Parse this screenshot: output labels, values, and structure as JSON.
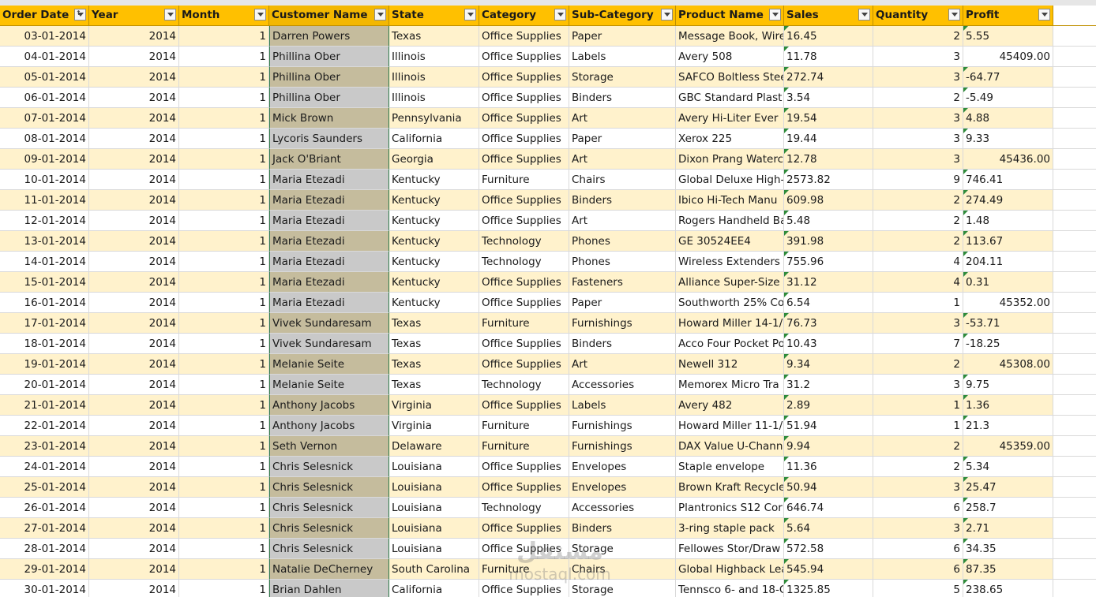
{
  "columns": [
    {
      "key": "order_date",
      "label": "Order Date"
    },
    {
      "key": "year",
      "label": "Year"
    },
    {
      "key": "month",
      "label": "Month"
    },
    {
      "key": "customer",
      "label": "Customer Name"
    },
    {
      "key": "state",
      "label": "State"
    },
    {
      "key": "category",
      "label": "Category"
    },
    {
      "key": "subcategory",
      "label": "Sub-Category"
    },
    {
      "key": "product",
      "label": "Product Name"
    },
    {
      "key": "sales",
      "label": "Sales"
    },
    {
      "key": "quantity",
      "label": "Quantity"
    },
    {
      "key": "profit",
      "label": "Profit"
    }
  ],
  "sorted_column": "order_date",
  "selected_column": "customer",
  "rows": [
    [
      "03-01-2014",
      "2014",
      "1",
      "Darren Powers",
      "Texas",
      "Office Supplies",
      "Paper",
      "Message Book, Wire",
      "16.45",
      "2",
      "5.55"
    ],
    [
      "04-01-2014",
      "2014",
      "1",
      "Phillina Ober",
      "Illinois",
      "Office Supplies",
      "Labels",
      "Avery 508",
      "11.78",
      "3",
      "45409.00"
    ],
    [
      "05-01-2014",
      "2014",
      "1",
      "Phillina Ober",
      "Illinois",
      "Office Supplies",
      "Storage",
      "SAFCO Boltless Stee",
      "272.74",
      "3",
      "-64.77"
    ],
    [
      "06-01-2014",
      "2014",
      "1",
      "Phillina Ober",
      "Illinois",
      "Office Supplies",
      "Binders",
      "GBC Standard Plast",
      "3.54",
      "2",
      "-5.49"
    ],
    [
      "07-01-2014",
      "2014",
      "1",
      "Mick Brown",
      "Pennsylvania",
      "Office Supplies",
      "Art",
      "Avery Hi-Liter Ever",
      "19.54",
      "3",
      "4.88"
    ],
    [
      "08-01-2014",
      "2014",
      "1",
      "Lycoris Saunders",
      "California",
      "Office Supplies",
      "Paper",
      "Xerox 225",
      "19.44",
      "3",
      "9.33"
    ],
    [
      "09-01-2014",
      "2014",
      "1",
      "Jack O'Briant",
      "Georgia",
      "Office Supplies",
      "Art",
      "Dixon Prang Waterc",
      "12.78",
      "3",
      "45436.00"
    ],
    [
      "10-01-2014",
      "2014",
      "1",
      "Maria Etezadi",
      "Kentucky",
      "Furniture",
      "Chairs",
      "Global Deluxe High-",
      "2573.82",
      "9",
      "746.41"
    ],
    [
      "11-01-2014",
      "2014",
      "1",
      "Maria Etezadi",
      "Kentucky",
      "Office Supplies",
      "Binders",
      "Ibico Hi-Tech Manu",
      "609.98",
      "2",
      "274.49"
    ],
    [
      "12-01-2014",
      "2014",
      "1",
      "Maria Etezadi",
      "Kentucky",
      "Office Supplies",
      "Art",
      "Rogers Handheld Ba",
      "5.48",
      "2",
      "1.48"
    ],
    [
      "13-01-2014",
      "2014",
      "1",
      "Maria Etezadi",
      "Kentucky",
      "Technology",
      "Phones",
      "GE 30524EE4",
      "391.98",
      "2",
      "113.67"
    ],
    [
      "14-01-2014",
      "2014",
      "1",
      "Maria Etezadi",
      "Kentucky",
      "Technology",
      "Phones",
      "Wireless Extenders",
      "755.96",
      "4",
      "204.11"
    ],
    [
      "15-01-2014",
      "2014",
      "1",
      "Maria Etezadi",
      "Kentucky",
      "Office Supplies",
      "Fasteners",
      "Alliance Super-Size",
      "31.12",
      "4",
      "0.31"
    ],
    [
      "16-01-2014",
      "2014",
      "1",
      "Maria Etezadi",
      "Kentucky",
      "Office Supplies",
      "Paper",
      "Southworth 25% Co",
      "6.54",
      "1",
      "45352.00"
    ],
    [
      "17-01-2014",
      "2014",
      "1",
      "Vivek Sundaresam",
      "Texas",
      "Furniture",
      "Furnishings",
      "Howard Miller 14-1/",
      "76.73",
      "3",
      "-53.71"
    ],
    [
      "18-01-2014",
      "2014",
      "1",
      "Vivek Sundaresam",
      "Texas",
      "Office Supplies",
      "Binders",
      "Acco Four Pocket Po",
      "10.43",
      "7",
      "-18.25"
    ],
    [
      "19-01-2014",
      "2014",
      "1",
      "Melanie Seite",
      "Texas",
      "Office Supplies",
      "Art",
      "Newell 312",
      "9.34",
      "2",
      "45308.00"
    ],
    [
      "20-01-2014",
      "2014",
      "1",
      "Melanie Seite",
      "Texas",
      "Technology",
      "Accessories",
      "Memorex Micro Tra",
      "31.2",
      "3",
      "9.75"
    ],
    [
      "21-01-2014",
      "2014",
      "1",
      "Anthony Jacobs",
      "Virginia",
      "Office Supplies",
      "Labels",
      "Avery 482",
      "2.89",
      "1",
      "1.36"
    ],
    [
      "22-01-2014",
      "2014",
      "1",
      "Anthony Jacobs",
      "Virginia",
      "Furniture",
      "Furnishings",
      "Howard Miller 11-1/",
      "51.94",
      "1",
      "21.3"
    ],
    [
      "23-01-2014",
      "2014",
      "1",
      "Seth Vernon",
      "Delaware",
      "Furniture",
      "Furnishings",
      "DAX Value U-Chann",
      "9.94",
      "2",
      "45359.00"
    ],
    [
      "24-01-2014",
      "2014",
      "1",
      "Chris Selesnick",
      "Louisiana",
      "Office Supplies",
      "Envelopes",
      "Staple envelope",
      "11.36",
      "2",
      "5.34"
    ],
    [
      "25-01-2014",
      "2014",
      "1",
      "Chris Selesnick",
      "Louisiana",
      "Office Supplies",
      "Envelopes",
      "Brown Kraft Recycle",
      "50.94",
      "3",
      "25.47"
    ],
    [
      "26-01-2014",
      "2014",
      "1",
      "Chris Selesnick",
      "Louisiana",
      "Technology",
      "Accessories",
      "Plantronics S12 Cor",
      "646.74",
      "6",
      "258.7"
    ],
    [
      "27-01-2014",
      "2014",
      "1",
      "Chris Selesnick",
      "Louisiana",
      "Office Supplies",
      "Binders",
      "3-ring staple pack",
      "5.64",
      "3",
      "2.71"
    ],
    [
      "28-01-2014",
      "2014",
      "1",
      "Chris Selesnick",
      "Louisiana",
      "Office Supplies",
      "Storage",
      "Fellowes Stor/Draw",
      "572.58",
      "6",
      "34.35"
    ],
    [
      "29-01-2014",
      "2014",
      "1",
      "Natalie DeCherney",
      "South Carolina",
      "Furniture",
      "Chairs",
      "Global Highback Lea",
      "545.94",
      "6",
      "87.35"
    ],
    [
      "30-01-2014",
      "2014",
      "1",
      "Brian Dahlen",
      "California",
      "Office Supplies",
      "Storage",
      "Tennsco 6- and 18-C",
      "1325.85",
      "5",
      "238.65"
    ]
  ],
  "watermark": {
    "arabic": "مستقل",
    "latin": "mostaql.com"
  },
  "colors": {
    "header": "#ffc000",
    "band": "#fff2cc",
    "selection_border": "#2f7a4a",
    "error_triangle": "#2e8b3a"
  }
}
